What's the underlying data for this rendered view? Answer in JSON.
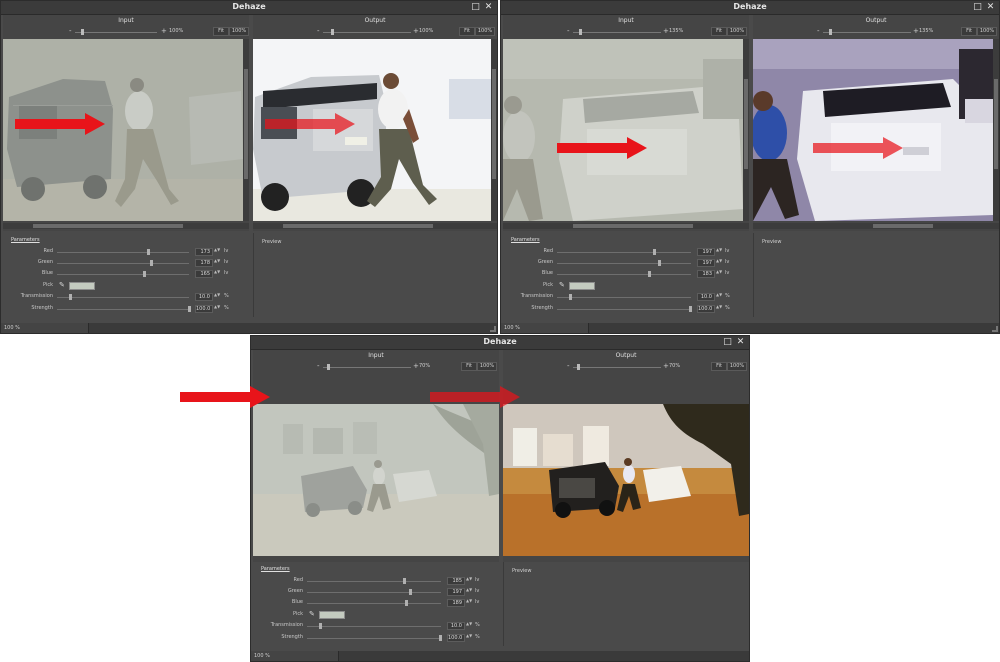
{
  "windows": [
    {
      "title": "Dehaze",
      "input": {
        "label": "Input",
        "zoom": "100%",
        "fit": "Fit",
        "pct": "100%"
      },
      "output": {
        "label": "Output",
        "zoom": "100%",
        "fit": "Fit",
        "pct": "100%"
      },
      "params_tab": "Parameters",
      "preview_label": "Preview",
      "status": "100 %",
      "rows": [
        {
          "label": "Red",
          "value": "173",
          "unit": "lv",
          "level": 0.68
        },
        {
          "label": "Green",
          "value": "178",
          "unit": "lv",
          "level": 0.7
        },
        {
          "label": "Blue",
          "value": "165",
          "unit": "lv",
          "level": 0.65
        },
        {
          "label": "Pick",
          "value": "",
          "unit": "",
          "level": 0
        },
        {
          "label": "Transmission",
          "value": "10.0",
          "unit": "%",
          "level": 0.1
        },
        {
          "label": "Strength",
          "value": "100.0",
          "unit": "%",
          "level": 1.0
        }
      ]
    },
    {
      "title": "Dehaze",
      "input": {
        "label": "Input",
        "zoom": "135%",
        "fit": "Fit",
        "pct": "100%"
      },
      "output": {
        "label": "Output",
        "zoom": "135%",
        "fit": "Fit",
        "pct": "100%"
      },
      "params_tab": "Parameters",
      "preview_label": "Preview",
      "status": "100 %",
      "rows": [
        {
          "label": "Red",
          "value": "197",
          "unit": "lv",
          "level": 0.77
        },
        {
          "label": "Green",
          "value": "197",
          "unit": "lv",
          "level": 0.77
        },
        {
          "label": "Blue",
          "value": "183",
          "unit": "lv",
          "level": 0.72
        },
        {
          "label": "Pick",
          "value": "",
          "unit": "",
          "level": 0
        },
        {
          "label": "Transmission",
          "value": "10.0",
          "unit": "%",
          "level": 0.1
        },
        {
          "label": "Strength",
          "value": "100.0",
          "unit": "%",
          "level": 1.0
        }
      ]
    },
    {
      "title": "Dehaze",
      "input": {
        "label": "Input",
        "zoom": "70%",
        "fit": "Fit",
        "pct": "100%"
      },
      "output": {
        "label": "Output",
        "zoom": "70%",
        "fit": "Fit",
        "pct": "100%"
      },
      "params_tab": "Parameters",
      "preview_label": "Preview",
      "status": "100 %",
      "rows": [
        {
          "label": "Red",
          "value": "185",
          "unit": "lv",
          "level": 0.72
        },
        {
          "label": "Green",
          "value": "197",
          "unit": "lv",
          "level": 0.77
        },
        {
          "label": "Blue",
          "value": "189",
          "unit": "lv",
          "level": 0.74
        },
        {
          "label": "Pick",
          "value": "",
          "unit": "",
          "level": 0
        },
        {
          "label": "Transmission",
          "value": "10.0",
          "unit": "%",
          "level": 0.1
        },
        {
          "label": "Strength",
          "value": "100.0",
          "unit": "%",
          "level": 1.0
        }
      ]
    }
  ],
  "icons": {
    "maximize": "□",
    "close": "✕",
    "minus": "-",
    "plus": "+",
    "spin": "▲▼",
    "eyedropper": "✎"
  },
  "colors": {
    "arrow": "#e8141a",
    "pick_swatch": "#c4cbc0",
    "window_bg": "#4a4a4a"
  }
}
